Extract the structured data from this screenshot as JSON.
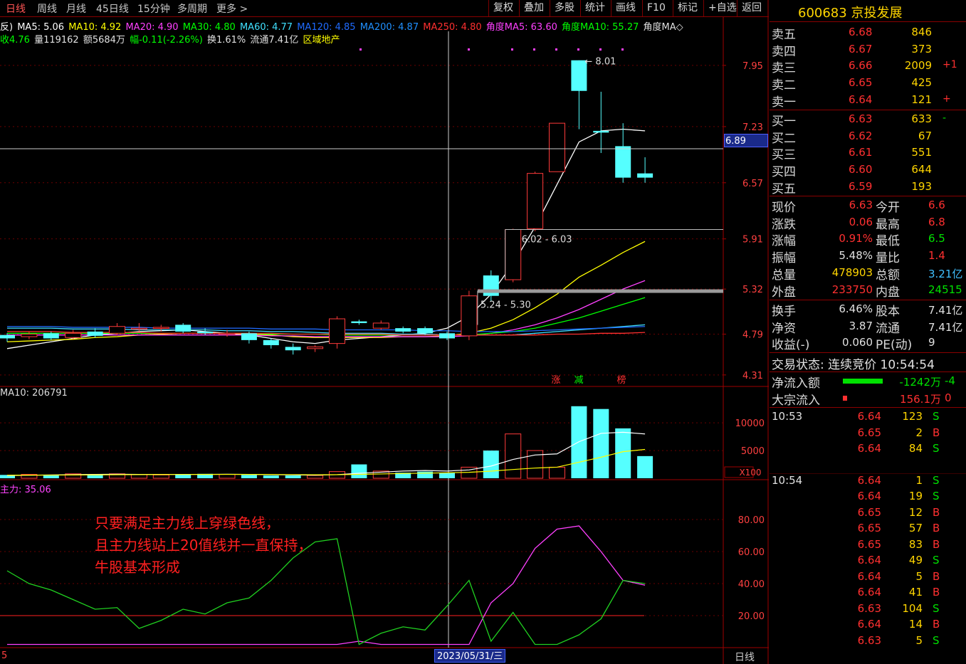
{
  "toolbar": {
    "period_tabs": [
      "日线",
      "周线",
      "月线",
      "45日线",
      "15分钟",
      "多周期",
      "更多 >"
    ],
    "active_tab": "日线",
    "tools": [
      "复权",
      "叠加",
      "多股",
      "统计",
      "画线",
      "F10",
      "标记",
      "+自选",
      "返回"
    ]
  },
  "indicators": {
    "line1": [
      {
        "text": "反)",
        "color": "#ffffff"
      },
      {
        "text": "MA5: 5.06",
        "color": "#ffffff"
      },
      {
        "text": "MA10: 4.92",
        "color": "#ffff00"
      },
      {
        "text": "MA20: 4.90",
        "color": "#ff40ff"
      },
      {
        "text": "MA30: 4.80",
        "color": "#00ff00"
      },
      {
        "text": "MA60: 4.77",
        "color": "#40e0ff"
      },
      {
        "text": "MA120: 4.85",
        "color": "#1f6bff"
      },
      {
        "text": "MA200: 4.87",
        "color": "#2090ff"
      },
      {
        "text": "MA250: 4.80",
        "color": "#ff3030"
      },
      {
        "text": "角度MA5: 63.60",
        "color": "#ff40ff"
      },
      {
        "text": "角度MA10: 55.27",
        "color": "#00ff00"
      },
      {
        "text": "角度MA◇",
        "color": "#e0e0e0"
      }
    ],
    "line2": [
      {
        "text": "收4.76",
        "color": "#00ff00"
      },
      {
        "text": "量119162",
        "color": "#e0e0e0"
      },
      {
        "text": "额5684万",
        "color": "#e0e0e0"
      },
      {
        "text": "幅-0.11(-2.26%)",
        "color": "#00ff00"
      },
      {
        "text": "换1.61%",
        "color": "#e0e0e0"
      },
      {
        "text": "流通7.41亿",
        "color": "#e0e0e0"
      },
      {
        "text": "区域地产",
        "color": "#ffff00"
      }
    ]
  },
  "price_axis": [
    "7.95",
    "7.23",
    "6.57",
    "5.91",
    "5.32",
    "4.79",
    "4.31"
  ],
  "crosshair_price": "6.89",
  "annotations": {
    "high_label": "8.01",
    "box_upper": "6.02 - 6.03",
    "box_lower": "5.24 - 5.30",
    "markers": [
      {
        "text": "涨",
        "color": "#ff3030"
      },
      {
        "text": "减",
        "color": "#00ff00"
      },
      {
        "text": "榜",
        "color": "#ff3030"
      }
    ]
  },
  "volume": {
    "label": "MA10: 206791",
    "axis": [
      "10000",
      "5000"
    ],
    "unit": "X100"
  },
  "main_force": {
    "label": "主力: 35.06",
    "axis": [
      "80.00",
      "60.00",
      "40.00",
      "20.00"
    ],
    "note": [
      "只要满足主力线上穿绿色线，",
      "且主力线站上20值线并一直保持，",
      "牛股基本形成"
    ]
  },
  "footer": {
    "left": "5",
    "date": "2023/05/31/三",
    "period": "日线"
  },
  "chart_data": {
    "type": "candlestick",
    "ylim": [
      4.2,
      8.2
    ],
    "candles": [
      {
        "o": 4.78,
        "c": 4.74,
        "h": 4.8,
        "l": 4.7
      },
      {
        "o": 4.76,
        "c": 4.79,
        "h": 4.82,
        "l": 4.73
      },
      {
        "o": 4.8,
        "c": 4.74,
        "h": 4.82,
        "l": 4.72
      },
      {
        "o": 4.75,
        "c": 4.8,
        "h": 4.84,
        "l": 4.73
      },
      {
        "o": 4.82,
        "c": 4.77,
        "h": 4.86,
        "l": 4.75
      },
      {
        "o": 4.8,
        "c": 4.88,
        "h": 4.92,
        "l": 4.78
      },
      {
        "o": 4.86,
        "c": 4.86,
        "h": 4.92,
        "l": 4.82
      },
      {
        "o": 4.86,
        "c": 4.87,
        "h": 4.9,
        "l": 4.82
      },
      {
        "o": 4.9,
        "c": 4.82,
        "h": 4.92,
        "l": 4.8
      },
      {
        "o": 4.82,
        "c": 4.8,
        "h": 4.86,
        "l": 4.78
      },
      {
        "o": 4.8,
        "c": 4.8,
        "h": 4.84,
        "l": 4.76
      },
      {
        "o": 4.8,
        "c": 4.72,
        "h": 4.82,
        "l": 4.68
      },
      {
        "o": 4.72,
        "c": 4.66,
        "h": 4.74,
        "l": 4.62
      },
      {
        "o": 4.64,
        "c": 4.6,
        "h": 4.68,
        "l": 4.55
      },
      {
        "o": 4.62,
        "c": 4.64,
        "h": 4.66,
        "l": 4.58
      },
      {
        "o": 4.68,
        "c": 4.97,
        "h": 5.0,
        "l": 4.62
      },
      {
        "o": 4.94,
        "c": 4.92,
        "h": 4.96,
        "l": 4.9
      },
      {
        "o": 4.86,
        "c": 4.92,
        "h": 4.95,
        "l": 4.84
      },
      {
        "o": 4.86,
        "c": 4.82,
        "h": 4.88,
        "l": 4.8
      },
      {
        "o": 4.86,
        "c": 4.8,
        "h": 4.88,
        "l": 4.78
      },
      {
        "o": 4.8,
        "c": 4.74,
        "h": 4.82,
        "l": 4.72
      },
      {
        "o": 4.77,
        "c": 5.24,
        "h": 5.3,
        "l": 4.72
      },
      {
        "o": 5.48,
        "c": 5.24,
        "h": 5.54,
        "l": 5.18
      },
      {
        "o": 5.43,
        "c": 6.02,
        "h": 6.03,
        "l": 5.4
      },
      {
        "o": 6.03,
        "c": 6.68,
        "h": 6.7,
        "l": 6.0
      },
      {
        "o": 6.7,
        "c": 7.27,
        "h": 7.27,
        "l": 6.7
      },
      {
        "o": 8.01,
        "c": 7.65,
        "h": 8.01,
        "l": 7.2
      },
      {
        "o": 7.18,
        "c": 7.16,
        "h": 7.64,
        "l": 6.92
      },
      {
        "o": 7.0,
        "c": 6.63,
        "h": 7.27,
        "l": 6.57
      },
      {
        "o": 6.68,
        "c": 6.63,
        "h": 6.87,
        "l": 6.57
      }
    ],
    "series": [
      {
        "name": "MA5",
        "color": "#ffffff",
        "values": [
          4.62,
          4.66,
          4.7,
          4.74,
          4.78,
          4.8,
          4.82,
          4.83,
          4.84,
          4.82,
          4.8,
          4.78,
          4.74,
          4.7,
          4.68,
          4.72,
          4.74,
          4.76,
          4.78,
          4.8,
          4.86,
          5.0,
          5.26,
          5.62,
          6.05,
          6.55,
          7.05,
          7.18,
          7.2,
          7.18
        ]
      },
      {
        "name": "MA10",
        "color": "#ffff00",
        "values": [
          4.7,
          4.71,
          4.72,
          4.73,
          4.75,
          4.76,
          4.78,
          4.79,
          4.8,
          4.8,
          4.8,
          4.79,
          4.78,
          4.76,
          4.75,
          4.75,
          4.75,
          4.75,
          4.76,
          4.76,
          4.77,
          4.8,
          4.86,
          4.96,
          5.1,
          5.26,
          5.46,
          5.6,
          5.75,
          5.88
        ]
      },
      {
        "name": "MA20",
        "color": "#ff40ff",
        "values": [
          4.78,
          4.78,
          4.78,
          4.78,
          4.78,
          4.78,
          4.78,
          4.78,
          4.78,
          4.78,
          4.78,
          4.78,
          4.77,
          4.77,
          4.76,
          4.76,
          4.76,
          4.76,
          4.76,
          4.76,
          4.76,
          4.77,
          4.8,
          4.84,
          4.9,
          4.98,
          5.08,
          5.2,
          5.32,
          5.42
        ]
      },
      {
        "name": "MA30",
        "color": "#00ff00",
        "values": [
          4.8,
          4.8,
          4.8,
          4.8,
          4.8,
          4.8,
          4.8,
          4.8,
          4.8,
          4.8,
          4.8,
          4.8,
          4.79,
          4.79,
          4.79,
          4.78,
          4.78,
          4.78,
          4.78,
          4.78,
          4.78,
          4.78,
          4.8,
          4.82,
          4.86,
          4.92,
          4.98,
          5.06,
          5.14,
          5.22
        ]
      },
      {
        "name": "MA60",
        "color": "#40e0ff",
        "values": [
          4.86,
          4.86,
          4.86,
          4.85,
          4.85,
          4.85,
          4.84,
          4.84,
          4.84,
          4.84,
          4.83,
          4.83,
          4.82,
          4.82,
          4.81,
          4.8,
          4.8,
          4.8,
          4.79,
          4.79,
          4.78,
          4.78,
          4.78,
          4.78,
          4.8,
          4.82,
          4.84,
          4.86,
          4.88,
          4.9
        ]
      },
      {
        "name": "MA120",
        "color": "#1f6bff",
        "values": [
          4.88,
          4.88,
          4.88,
          4.87,
          4.87,
          4.87,
          4.87,
          4.86,
          4.86,
          4.86,
          4.86,
          4.86,
          4.85,
          4.85,
          4.85,
          4.84,
          4.84,
          4.84,
          4.84,
          4.83,
          4.83,
          4.82,
          4.82,
          4.82,
          4.83,
          4.84,
          4.85,
          4.86,
          4.87,
          4.88
        ]
      },
      {
        "name": "MA250",
        "color": "#ff3030",
        "values": [
          4.82,
          4.82,
          4.82,
          4.81,
          4.81,
          4.81,
          4.81,
          4.8,
          4.8,
          4.8,
          4.8,
          4.8,
          4.8,
          4.79,
          4.79,
          4.79,
          4.79,
          4.79,
          4.78,
          4.78,
          4.78,
          4.78,
          4.78,
          4.78,
          4.78,
          4.79,
          4.79,
          4.8,
          4.8,
          4.81
        ]
      }
    ],
    "volume": {
      "ylim": [
        0,
        14000
      ],
      "values": [
        600,
        700,
        600,
        800,
        700,
        800,
        700,
        600,
        700,
        800,
        700,
        600,
        500,
        500,
        500,
        1200,
        2500,
        1300,
        1000,
        1200,
        1000,
        2000,
        5000,
        8000,
        5000,
        2000,
        13000,
        12500,
        9000,
        4000
      ],
      "ma": [
        {
          "name": "MA5",
          "color": "#ffffff",
          "values": [
            500,
            550,
            600,
            650,
            700,
            720,
            700,
            700,
            700,
            700,
            720,
            700,
            650,
            600,
            560,
            650,
            900,
            1100,
            1300,
            1400,
            1300,
            1500,
            2200,
            3400,
            4200,
            4400,
            6600,
            8100,
            8300,
            8000
          ]
        },
        {
          "name": "MA10",
          "color": "#ffff00",
          "values": [
            550,
            560,
            570,
            590,
            610,
            640,
            660,
            670,
            680,
            690,
            700,
            690,
            670,
            650,
            630,
            640,
            700,
            780,
            860,
            920,
            980,
            1080,
            1280,
            1580,
            1840,
            2000,
            2900,
            3800,
            4800,
            5200
          ]
        }
      ]
    },
    "main_force": {
      "ylim": [
        0,
        100
      ],
      "threshold": 20,
      "series": [
        {
          "name": "主力",
          "color": "#ff40ff",
          "values": [
            2,
            2,
            2,
            2,
            2,
            2,
            2,
            2,
            2,
            2,
            2,
            2,
            2,
            2,
            2,
            2,
            4,
            2,
            2,
            2,
            2,
            2,
            28,
            40,
            62,
            74,
            76,
            60,
            42,
            39
          ]
        },
        {
          "name": "",
          "color": "#20d020",
          "values": [
            48,
            40,
            36,
            30,
            24,
            25,
            12,
            17,
            24,
            21,
            28,
            31,
            42,
            56,
            66,
            68,
            2,
            9,
            13,
            11,
            26,
            42,
            4,
            22,
            2,
            2,
            8,
            18,
            42,
            40
          ]
        }
      ]
    }
  },
  "stock": {
    "code": "600683",
    "name": "京投发展"
  },
  "order_book": {
    "sell": [
      {
        "label": "卖五",
        "price": "6.68",
        "qty": "846",
        "chg": ""
      },
      {
        "label": "卖四",
        "price": "6.67",
        "qty": "373",
        "chg": ""
      },
      {
        "label": "卖三",
        "price": "6.66",
        "qty": "2009",
        "chg": "+1"
      },
      {
        "label": "卖二",
        "price": "6.65",
        "qty": "425",
        "chg": ""
      },
      {
        "label": "卖一",
        "price": "6.64",
        "qty": "121",
        "chg": "+"
      }
    ],
    "buy": [
      {
        "label": "买一",
        "price": "6.63",
        "qty": "633",
        "chg": "-"
      },
      {
        "label": "买二",
        "price": "6.62",
        "qty": "67",
        "chg": ""
      },
      {
        "label": "买三",
        "price": "6.61",
        "qty": "551",
        "chg": ""
      },
      {
        "label": "买四",
        "price": "6.60",
        "qty": "644",
        "chg": ""
      },
      {
        "label": "买五",
        "price": "6.59",
        "qty": "193",
        "chg": ""
      }
    ]
  },
  "quote": [
    {
      "l1": "现价",
      "v1": "6.63",
      "c1": "red",
      "l2": "今开",
      "v2": "6.6",
      "c2": "red"
    },
    {
      "l1": "涨跌",
      "v1": "0.06",
      "c1": "red",
      "l2": "最高",
      "v2": "6.8",
      "c2": "red"
    },
    {
      "l1": "涨幅",
      "v1": "0.91%",
      "c1": "red",
      "l2": "最低",
      "v2": "6.5",
      "c2": "green"
    },
    {
      "l1": "振幅",
      "v1": "5.48%",
      "c1": "white",
      "l2": "量比",
      "v2": "1.4",
      "c2": "red"
    },
    {
      "l1": "总量",
      "v1": "478903",
      "c1": "yellow",
      "l2": "总额",
      "v2": "3.21亿",
      "c2": "#40c0ff"
    },
    {
      "l1": "外盘",
      "v1": "233750",
      "c1": "red",
      "l2": "内盘",
      "v2": "24515",
      "c2": "green"
    }
  ],
  "quote2": [
    {
      "l1": "换手",
      "v1": "6.46%",
      "c1": "white",
      "l2": "股本",
      "v2": "7.41亿",
      "c2": "white"
    },
    {
      "l1": "净资",
      "v1": "3.87",
      "c1": "white",
      "l2": "流通",
      "v2": "7.41亿",
      "c2": "white"
    },
    {
      "l1": "收益(-)",
      "v1": "0.060",
      "c1": "white",
      "l2": "PE(动)",
      "v2": "9",
      "c2": "white"
    }
  ],
  "trade_status": "交易状态: 连续竞价 10:54:54",
  "flow": [
    {
      "label": "净流入额",
      "value": "-1242万",
      "tail": "-4",
      "color": "#00e000"
    },
    {
      "label": "大宗流入",
      "value": "156.1万",
      "tail": "0",
      "color": "#ff3030"
    }
  ],
  "ticks": [
    {
      "t": "10:53",
      "p": "6.64",
      "v": "123",
      "d": "S"
    },
    {
      "t": "",
      "p": "6.65",
      "v": "2",
      "d": "B"
    },
    {
      "t": "",
      "p": "6.64",
      "v": "84",
      "d": "S"
    },
    {
      "t": "10:54",
      "p": "6.64",
      "v": "1",
      "d": "S"
    },
    {
      "t": "",
      "p": "6.64",
      "v": "19",
      "d": "S"
    },
    {
      "t": "",
      "p": "6.65",
      "v": "12",
      "d": "B"
    },
    {
      "t": "",
      "p": "6.65",
      "v": "57",
      "d": "B"
    },
    {
      "t": "",
      "p": "6.65",
      "v": "83",
      "d": "B"
    },
    {
      "t": "",
      "p": "6.64",
      "v": "49",
      "d": "S"
    },
    {
      "t": "",
      "p": "6.64",
      "v": "5",
      "d": "B"
    },
    {
      "t": "",
      "p": "6.64",
      "v": "41",
      "d": "B"
    },
    {
      "t": "",
      "p": "6.63",
      "v": "104",
      "d": "S"
    },
    {
      "t": "",
      "p": "6.64",
      "v": "14",
      "d": "B"
    },
    {
      "t": "",
      "p": "6.63",
      "v": "5",
      "d": "S"
    }
  ]
}
